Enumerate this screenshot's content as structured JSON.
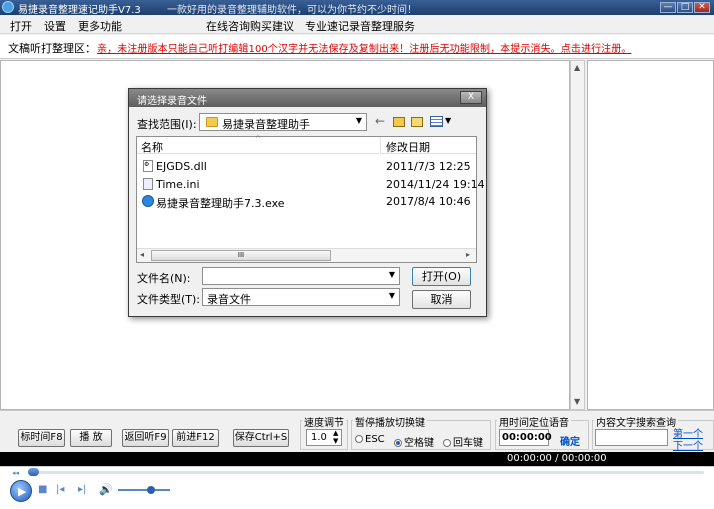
{
  "window": {
    "title": "易捷录音整理速记助手V7.3",
    "subtitle": "一款好用的录音整理辅助软件，可以为你节约不少时间！",
    "min": "—",
    "max": "□",
    "close": "✕"
  },
  "menu": {
    "items": [
      "打开",
      "设置",
      "更多功能",
      "在线咨询购买建议",
      "专业速记录音整理服务"
    ]
  },
  "notice": {
    "label": "文稿听打整理区：",
    "message": "亲，未注册版本只能自己听打编辑100个汉字并无法保存及复制出来！注册后无功能限制，本提示消失。点击进行注册。"
  },
  "dialog": {
    "title": "请选择录音文件",
    "close": "X",
    "lookin_label": "查找范围(I):",
    "lookin_value": "易捷录音整理助手",
    "columns": {
      "name": "名称",
      "modified": "修改日期"
    },
    "files": [
      {
        "name": "EJGDS.dll",
        "date": "2011/7/3 12:25",
        "icon": "dll-file-icon"
      },
      {
        "name": "Time.ini",
        "date": "2014/11/24 19:14",
        "icon": "ini-file-icon"
      },
      {
        "name": "易捷录音整理助手7.3.exe",
        "date": "2017/8/4 10:46",
        "icon": "app-exe-icon"
      }
    ],
    "hscroll_thumb": "III",
    "filename_label": "文件名(N):",
    "filename_value": "",
    "filetype_label": "文件类型(T):",
    "filetype_value": "录音文件",
    "open_button": "打开(O)",
    "cancel_button": "取消"
  },
  "controls": {
    "mark_time": "标时间F8",
    "play": "播 放",
    "back": "返回听F9",
    "forward": "前进F12",
    "save": "保存Ctrl+S",
    "speed_label": "速度调节",
    "speed_value": "1.0",
    "pause_label": "暂停播放切换键",
    "pause_options": [
      "ESC",
      "空格键",
      "回车键"
    ],
    "pause_selected": 1,
    "locate_label": "用时间定位语音",
    "locate_value": "00:00:00",
    "locate_button": "确定",
    "search_label": "内容文字搜索查询",
    "search_value": "",
    "prev": "第一个",
    "next": "下一个"
  },
  "player": {
    "time": "00:00:00 / 00:00:00",
    "progress": 0.0,
    "volume": 0.65
  }
}
